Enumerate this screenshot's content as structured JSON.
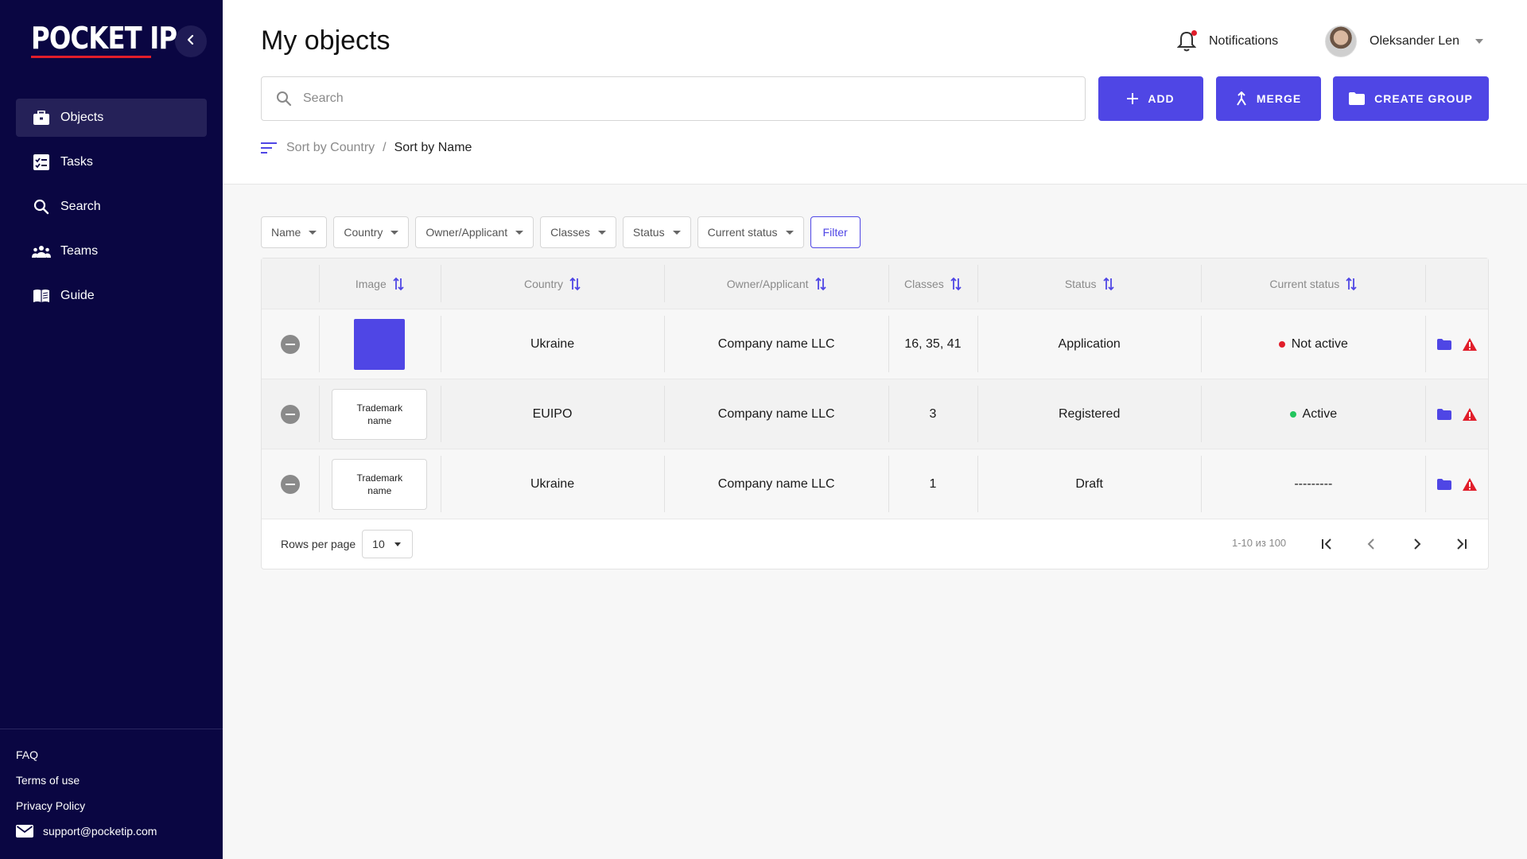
{
  "app": {
    "logo": "POCKET IP"
  },
  "sidebar": {
    "items": [
      {
        "label": "Objects",
        "icon": "briefcase-icon",
        "active": true
      },
      {
        "label": "Tasks",
        "icon": "task-check-icon"
      },
      {
        "label": "Search",
        "icon": "search-icon"
      },
      {
        "label": "Teams",
        "icon": "teams-icon"
      },
      {
        "label": "Guide",
        "icon": "book-icon"
      }
    ],
    "footer": {
      "faq": "FAQ",
      "terms": "Terms of use",
      "privacy": "Privacy Policy",
      "email": "support@pocketip.com"
    }
  },
  "header": {
    "title": "My objects",
    "notifications": "Notifications",
    "user_name": "Oleksander Len",
    "search_placeholder": "Search",
    "add_label": "ADD",
    "merge_label": "MERGE",
    "create_group_label": "CREATE GROUP",
    "sort_country": "Sort by Country",
    "sort_sep": "/",
    "sort_name": "Sort by Name"
  },
  "filters": {
    "chips": [
      "Name",
      "Country",
      "Owner/Applicant",
      "Classes",
      "Status",
      "Current status"
    ],
    "filter_label": "Filter"
  },
  "table": {
    "headers": [
      "Image",
      "Country",
      "Owner/Applicant",
      "Classes",
      "Status",
      "Current status"
    ],
    "rows": [
      {
        "image": "",
        "country": "Ukraine",
        "owner": "Company name LLC",
        "classes": "16, 35, 41",
        "status": "Application",
        "current_status": "Not active",
        "current_color": "#e11d2a"
      },
      {
        "image": "Trademark name",
        "country": "EUIPO",
        "owner": "Company name LLC",
        "classes": "3",
        "status": "Registered",
        "current_status": "Active",
        "current_color": "#22c55e"
      },
      {
        "image": "Trademark name",
        "country": "Ukraine",
        "owner": "Company name LLC",
        "classes": "1",
        "status": "Draft",
        "current_status": "---------",
        "current_color": ""
      }
    ]
  },
  "pagination": {
    "rows_per_page_label": "Rows per page",
    "rows_per_page": "10",
    "range": "1-10 из 100"
  },
  "colors": {
    "accent": "#4f46e5",
    "sidebar": "#0a0642",
    "danger": "#e11d2a",
    "success": "#22c55e"
  }
}
